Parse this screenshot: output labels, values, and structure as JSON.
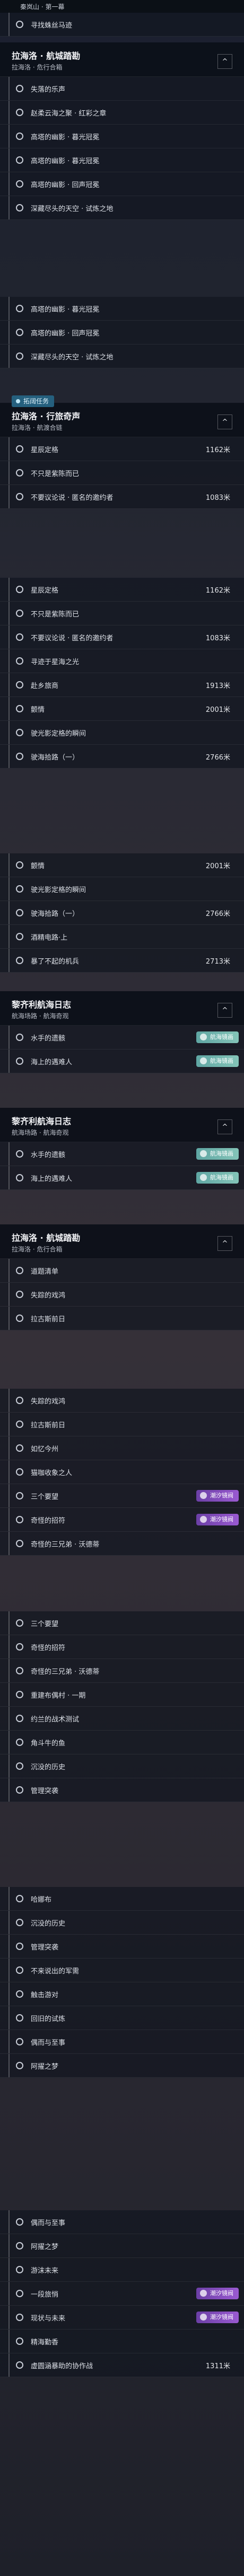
{
  "top_title": "秦岚山 · 第一幕",
  "seg1_rows": [
    "寻找蛛丝马迹"
  ],
  "quest_main": {
    "title": "拉海洛 · 航城踏勘",
    "sub": "拉海洛 · 危行合箱"
  },
  "seg2_rows": [
    "失落的乐声",
    "赵柔云海之聚 · 红彩之章",
    "高塔的幽影 · 暮光冠冕",
    "高塔的幽影 · 暮光冠冕",
    "高塔的幽影 · 回声冠冕",
    "深藏尽头的天空 · 试炼之地"
  ],
  "seg3_rows": [
    "高塔的幽影 · 暮光冠冕",
    "高塔的幽影 · 回声冠冕",
    "深藏尽头的天空 · 试炼之地"
  ],
  "quest_tag": "拓阔任务",
  "quest_second": {
    "title": "拉海洛 · 行旅奇声",
    "sub": "拉海洛 · 航渡合链"
  },
  "seg4_rows": [
    {
      "label": "星辰定格",
      "dist": "1162米"
    },
    {
      "label": "不只是紫陈而已",
      "dist": ""
    },
    {
      "label": "不要议论说 · 匿名的邀约者",
      "dist": "1083米"
    }
  ],
  "seg5_rows": [
    {
      "label": "星辰定格",
      "dist": "1162米"
    },
    {
      "label": "不只是紫陈而已",
      "dist": ""
    },
    {
      "label": "不要议论说 · 匿名的邀约者",
      "dist": "1083米"
    },
    {
      "label": "寻迹于星海之光",
      "dist": ""
    },
    {
      "label": "赴乡旅商",
      "dist": "1913米"
    },
    {
      "label": "颤情",
      "dist": "2001米"
    },
    {
      "label": "驶光影定格的瞬间",
      "dist": ""
    },
    {
      "label": "驶海拾路（一）",
      "dist": "2766米"
    }
  ],
  "seg6_rows": [
    {
      "label": "颤情",
      "dist": "2001米"
    },
    {
      "label": "驶光影定格的瞬间",
      "dist": ""
    },
    {
      "label": "驶海拾路（一）",
      "dist": "2766米"
    },
    {
      "label": "酒精电路·上",
      "dist": ""
    },
    {
      "label": "暴了不起的机兵",
      "dist": "2713米"
    }
  ],
  "quest_log1": {
    "title": "黎齐利航海日志",
    "sub": "航海场路 · 航海奇观"
  },
  "seg7_rows": [
    "水手的遗骸",
    "海上的遇难人"
  ],
  "badge_hang": "航海镜画",
  "badge_chao": "潮汐镜阀",
  "seg8_rows": [
    "水手的遗骸",
    "海上的遇难人"
  ],
  "seg9_rows": [
    "道题清单",
    "失踪的戏鸿",
    "拉古斯前日"
  ],
  "seg10_rows": [
    "失踪的戏鸿",
    "拉古斯前日",
    "如忆今州",
    "猫咖收象之人",
    "三个要望",
    "奇怪的招符",
    "奇怪的三兄弟 · 沃德蒂"
  ],
  "seg11_rows": [
    "三个要望",
    "奇怪的招符",
    "奇怪的三兄弟 · 沃德蒂",
    "重建布偶村 · 一期",
    "约兰的战术测试",
    "角斗牛的鱼",
    "沉没的历史",
    "管理突袭"
  ],
  "seg12_rows": [
    "哈娜布",
    "沉没的历史",
    "管理突袭",
    "不来说出的军需",
    "触击游对",
    "回旧的试炼",
    "偶而与至事",
    "阿擢之梦"
  ],
  "seg13_rows": [
    "偶而与至事",
    "阿擢之梦",
    "游沫未来",
    "一段旅悄",
    "现状与未来",
    "精海勤香",
    "虚圆涵暴助的协作战"
  ],
  "seg13_dist": "1311米"
}
